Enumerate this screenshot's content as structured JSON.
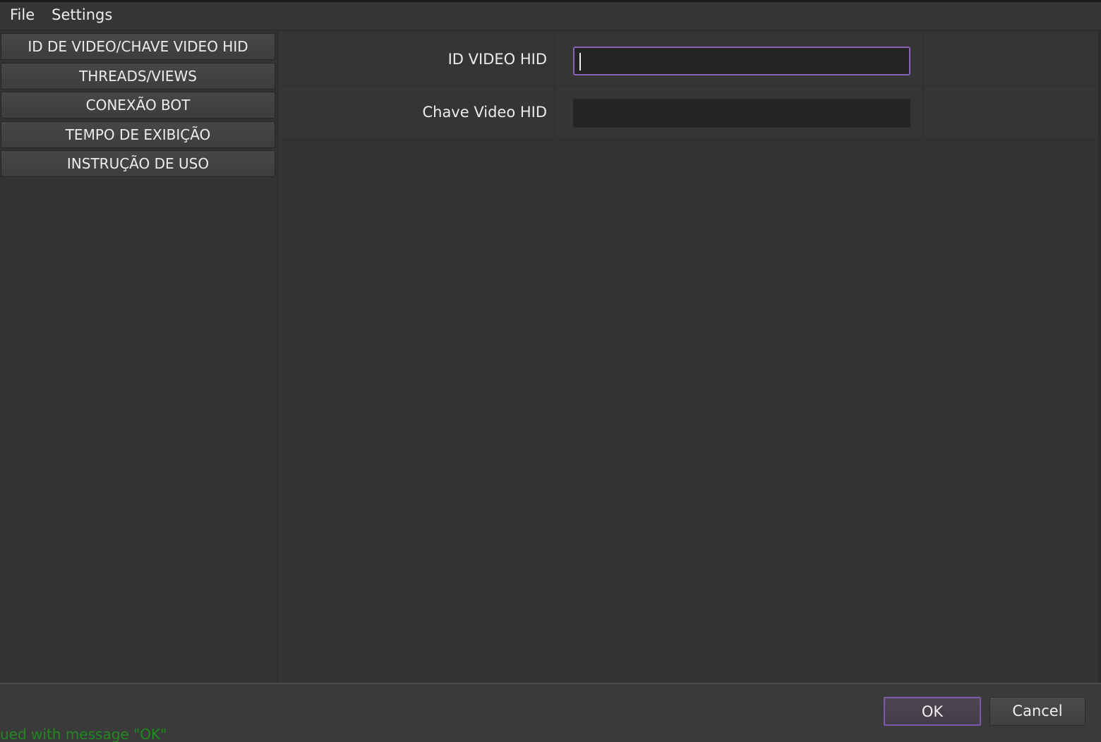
{
  "menubar": {
    "items": [
      "File",
      "Settings"
    ]
  },
  "sidebar": {
    "items": [
      {
        "label": "ID DE VIDEO/CHAVE VIDEO HID"
      },
      {
        "label": "THREADS/VIEWS"
      },
      {
        "label": "CONEXÃO BOT"
      },
      {
        "label": "TEMPO DE EXIBIÇÃO"
      },
      {
        "label": "INSTRUÇÃO DE USO"
      }
    ]
  },
  "form": {
    "fields": [
      {
        "label": "ID VIDEO HID",
        "value": "",
        "focused": true
      },
      {
        "label": "Chave Video HID",
        "value": "",
        "focused": false
      }
    ]
  },
  "dialog": {
    "ok_label": "OK",
    "cancel_label": "Cancel"
  },
  "console": {
    "text": "ued with message \"OK\""
  },
  "colors": {
    "accent": "#8a63b8",
    "console_text": "#1f8a1f"
  }
}
